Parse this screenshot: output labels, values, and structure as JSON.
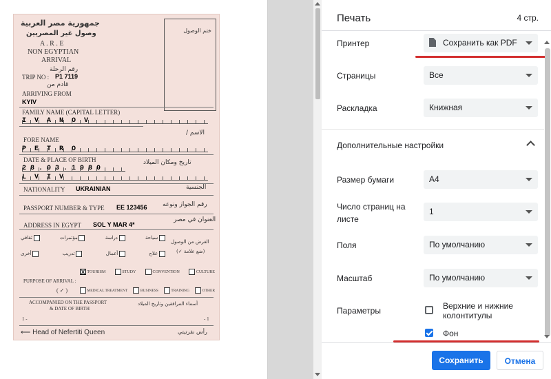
{
  "panel": {
    "title": "Печать",
    "page_count": "4 стр.",
    "printer": {
      "label": "Принтер",
      "value": "Сохранить как PDF"
    },
    "pages": {
      "label": "Страницы",
      "value": "Все"
    },
    "layout": {
      "label": "Раскладка",
      "value": "Книжная"
    },
    "more_settings": {
      "label": "Дополнительные настройки",
      "state": "expanded"
    },
    "paper_size": {
      "label": "Размер бумаги",
      "value": "A4"
    },
    "pages_per_sheet": {
      "label_line1": "Число страниц на",
      "label_line2": "листе",
      "value": "1"
    },
    "margins": {
      "label": "Поля",
      "value": "По умолчанию"
    },
    "scale": {
      "label": "Масштаб",
      "value": "По умолчанию"
    },
    "options": {
      "label": "Параметры",
      "headers_footers": {
        "label_line1": "Верхние и нижние",
        "label_line2": "колонтитулы",
        "checked": false
      },
      "background": {
        "label": "Фон",
        "checked": true
      }
    },
    "save_button": "Сохранить",
    "cancel_button": "Отмена",
    "accent_color": "#1a73e8",
    "highlight_color": "#d32f2f"
  },
  "card": {
    "title_ar": "جمهورية مصر العربية",
    "subtitle_ar": "وصول غير المصريين",
    "are": "A . R . E",
    "non_egyptian": "NON EGYPTIAN",
    "arrival": "ARRIVAL",
    "stamp_ar": "ختم الوصول",
    "trip_ar": "رقم الرحلة",
    "trip_label": "TRIP NO :",
    "trip_value": "P1 7119",
    "from_ar": "قادم من",
    "arriving_from_label": "ARRIVING FROM",
    "arriving_from_value": "KYIV",
    "family_name_label": "FAMILY NAME (CAPITAL LETTER)",
    "family_name_value": "IVANOV",
    "name_ar": "الاسم /",
    "fore_name_label": "FORE NAME",
    "fore_name_value": "PETRO",
    "dob_label": "DATE & PLACE OF BIRTH",
    "dob_ar": "تاريخ ومكان الميلاد",
    "dob_value": "28.03.1980",
    "pob_value": "LVIV",
    "nationality_label": "NATIONALITY",
    "nationality_value": "UKRAINIAN",
    "nationality_ar": "الجنسية",
    "passport_label": "PASSPORT NUMBER & TYPE",
    "passport_value": "EE 123456",
    "passport_ar": "رقم الجواز ونوعه",
    "address_label": "ADDRESS IN EGYPT",
    "address_value": "SOL Y MAR 4*",
    "address_ar": "العنوان في مصر",
    "purpose_ar_row1": [
      "ثقافي",
      "مؤتمرات",
      "دراسة",
      "سياحة"
    ],
    "purpose_ar_row2": [
      "أخرى",
      "تدريب",
      "أعمال",
      "علاج"
    ],
    "purpose_ar_label": "الغرض من الوصول",
    "purpose_ar_hint": "(ضع علامة ✓)",
    "purpose_label": "PURPOSE OF ARRIVAL :",
    "purpose_en_row1": [
      "TOURISM",
      "STUDY",
      "CONVENTION",
      "CULTURE"
    ],
    "purpose_en_row2": [
      "MEDICAL TREATMENT",
      "BUSINESS",
      "TRAINING",
      "OTHER"
    ],
    "tick_hint": "( ✓ )",
    "accompanied_line1": "ACCOMPANIED ON THE PASSPORT",
    "accompanied_line2": "& DATE OF BIRTH",
    "accompanied_ar": "أسماء المرافقين وتاريخ الميلاد",
    "one_left": "1 -",
    "one_right": "- 1",
    "footer_en": "Head of Nefertiti Queen",
    "footer_ar": "رأس نفرتيتي"
  }
}
